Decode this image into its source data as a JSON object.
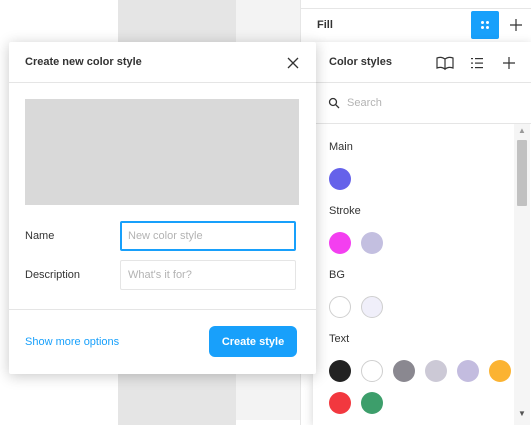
{
  "fill_panel": {
    "label": "Fill",
    "add_icon": "plus-icon",
    "styles_icon": "grid-dots-icon"
  },
  "color_styles": {
    "title": "Color styles",
    "icons": [
      "library-book-icon",
      "list-view-icon",
      "plus-icon"
    ],
    "search": {
      "placeholder": "Search",
      "value": ""
    },
    "groups": [
      {
        "label": "Main",
        "swatches": [
          "#6562ea"
        ]
      },
      {
        "label": "Stroke",
        "swatches": [
          "#f33ff0",
          "#c3bfe0"
        ]
      },
      {
        "label": "BG",
        "swatches": [
          "#ffffff",
          "#f0effa"
        ]
      },
      {
        "label": "Text",
        "swatches": [
          "#222222",
          "#ffffff",
          "#8a8890",
          "#ccc9d6",
          "#c3bcdf",
          "#fbb332",
          "#f2383f",
          "#3d9e6b"
        ]
      }
    ]
  },
  "modal": {
    "title": "Create new color style",
    "preview_color": "#d9d9d9",
    "name_label": "Name",
    "name_placeholder": "New color style",
    "name_value": "",
    "description_label": "Description",
    "description_placeholder": "What's it for?",
    "description_value": "",
    "more_options_label": "Show more options",
    "create_label": "Create style"
  },
  "colors": {
    "accent": "#18a0fb"
  }
}
